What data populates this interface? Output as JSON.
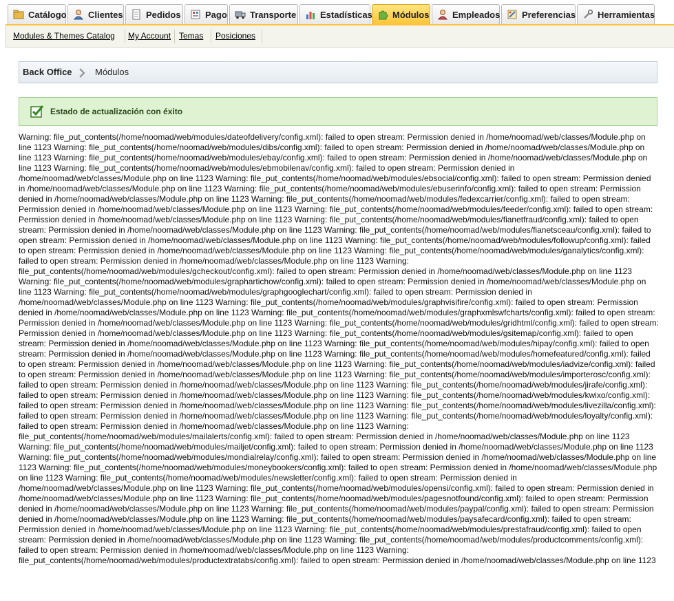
{
  "tabs": [
    {
      "label": "Catálogo",
      "icon": "catalog-icon",
      "active": false
    },
    {
      "label": "Clientes",
      "icon": "customers-icon",
      "active": false
    },
    {
      "label": "Pedidos",
      "icon": "orders-icon",
      "active": false
    },
    {
      "label": "Pago",
      "icon": "payment-icon",
      "active": false
    },
    {
      "label": "Transporte",
      "icon": "truck-icon",
      "active": false
    },
    {
      "label": "Estadísticas",
      "icon": "stats-icon",
      "active": false
    },
    {
      "label": "Módulos",
      "icon": "puzzle-icon",
      "active": true
    },
    {
      "label": "Empleados",
      "icon": "employees-icon",
      "active": false
    },
    {
      "label": "Preferencias",
      "icon": "preferences-icon",
      "active": false
    },
    {
      "label": "Herramientas",
      "icon": "tools-icon",
      "active": false
    }
  ],
  "submenu": [
    {
      "label": "Modules & Themes Catalog"
    },
    {
      "label": "My Account"
    },
    {
      "label": "Temas"
    },
    {
      "label": "Posiciones"
    }
  ],
  "breadcrumb": {
    "home": "Back Office",
    "current": "Módulos"
  },
  "success": {
    "message": "Estado de actualización con éxito"
  },
  "colors": {
    "active_tab": "#fcc53a",
    "success_bg": "#dff3d3",
    "success_border": "#9fd08f"
  },
  "warning_modules": [
    "dateofdelivery",
    "dibs",
    "ebay",
    "ebmobilenav",
    "ebsocial",
    "ebuserinfo",
    "fedexcarrier",
    "feeder",
    "fianetfraud",
    "fianetsceau",
    "followup",
    "ganalytics",
    "gcheckout",
    "graphartichow",
    "graphgooglechart",
    "graphvisifire",
    "graphxmlswfcharts",
    "gridhtml",
    "gsitemap",
    "hipay",
    "homefeatured",
    "iadvize",
    "importerosc",
    "jirafe",
    "kwixo",
    "livezilla",
    "loyalty",
    "mailalerts",
    "mailjet",
    "mondialrelay",
    "moneybookers",
    "newsletter",
    "opensi",
    "pagesnotfound",
    "paypal",
    "paysafecard",
    "prestafraud",
    "productcomments",
    "productextratabs"
  ],
  "warning_template": {
    "prefix": "Warning: file_put_contents(/home/noomad/web/modules/",
    "suffix": "/config.xml): failed to open stream: Permission denied in /home/noomad/web/classes/Module.php on line 1123"
  }
}
